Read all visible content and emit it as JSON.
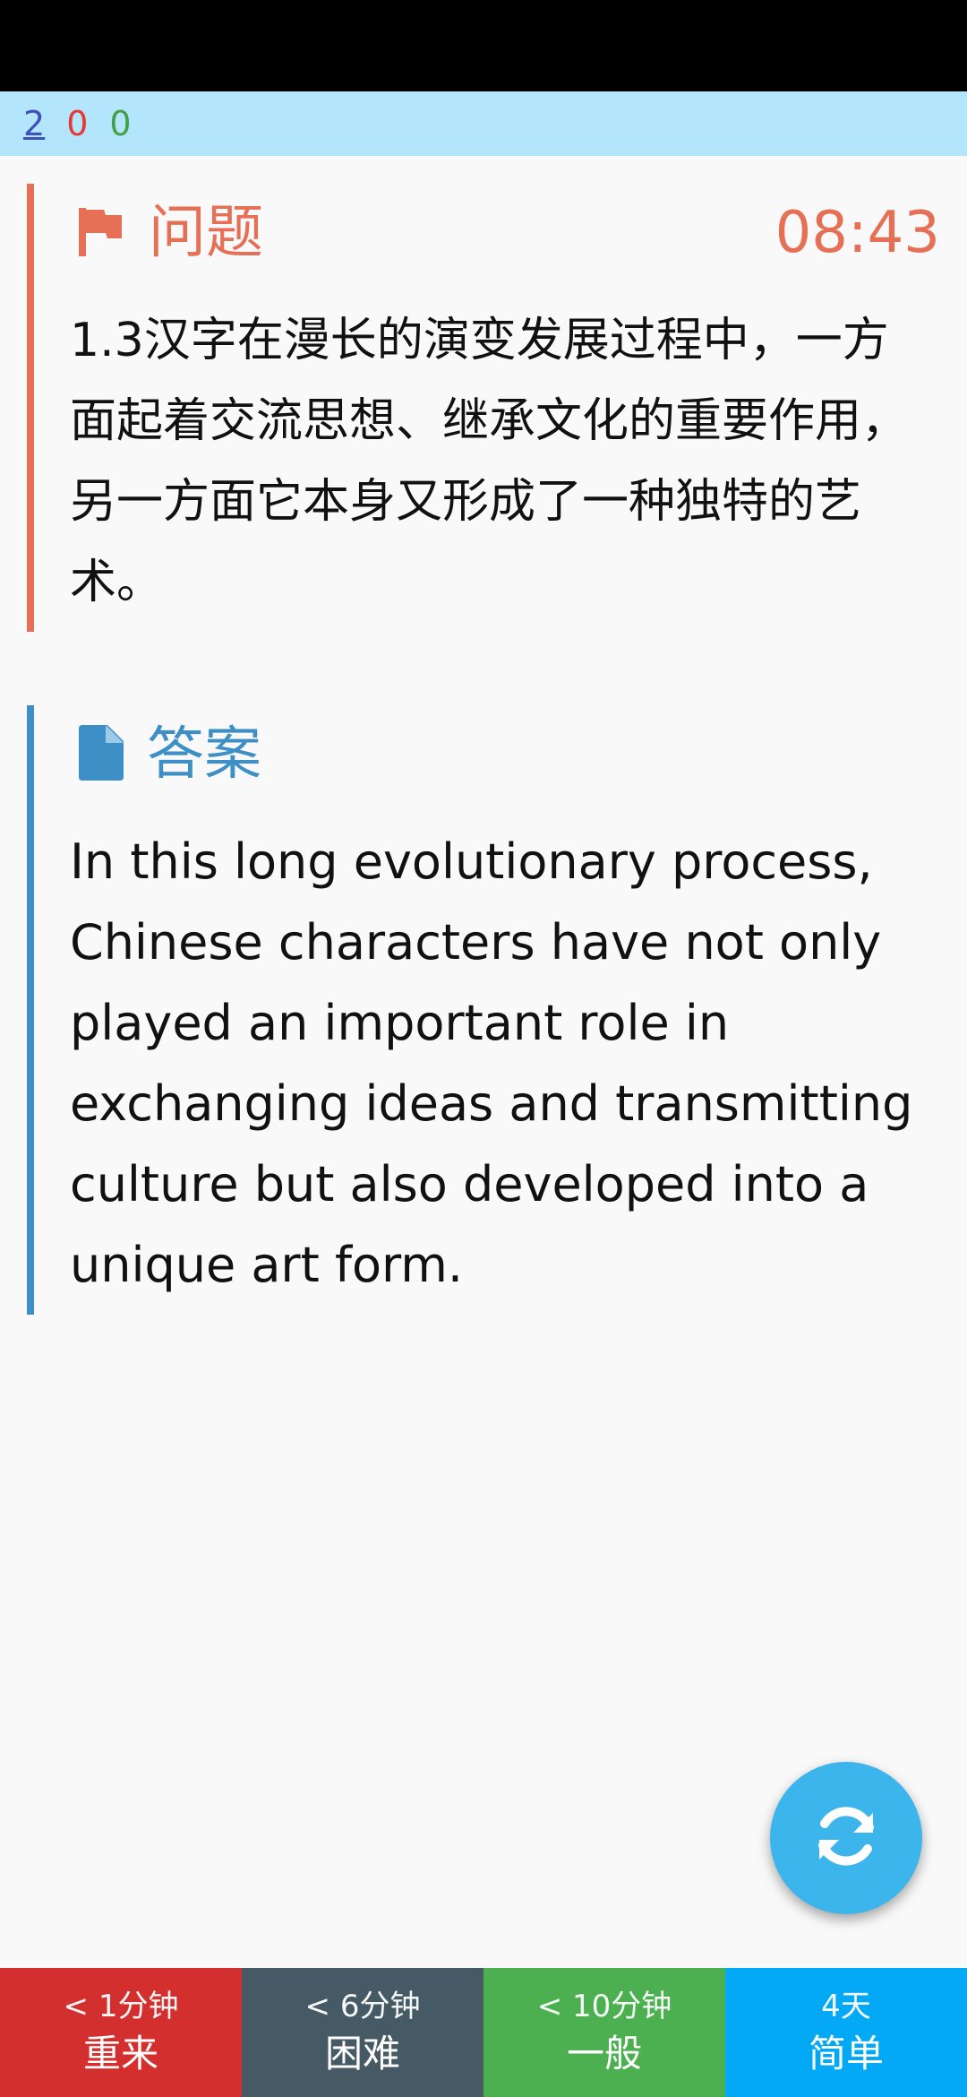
{
  "counts": {
    "new": "2",
    "learning": "0",
    "review": "0"
  },
  "question": {
    "title": "问题",
    "timer": "08:43",
    "text": "1.3汉字在漫长的演变发展过程中，一方面起着交流思想、继承文化的重要作用，另一方面它本身又形成了一种独特的艺术。"
  },
  "answer": {
    "title": "答案",
    "text": "In this long evolutionary process, Chinese characters have not only played an important role in exchanging ideas and transmitting culture but also developed into a unique art form."
  },
  "buttons": {
    "again": {
      "interval": "< 1分钟",
      "label": "重来"
    },
    "hard": {
      "interval": "< 6分钟",
      "label": "困难"
    },
    "good": {
      "interval": "< 10分钟",
      "label": "一般"
    },
    "easy": {
      "interval": "4天",
      "label": "简单"
    }
  },
  "colors": {
    "question_accent": "#e57055",
    "answer_accent": "#3d8fc6",
    "fab": "#3cb4ec",
    "again": "#d32f2f",
    "hard": "#455a64",
    "good": "#4caf50",
    "easy": "#03a9f4"
  },
  "icons": {
    "question": "flag-icon",
    "answer": "document-icon",
    "fab": "refresh-icon"
  }
}
